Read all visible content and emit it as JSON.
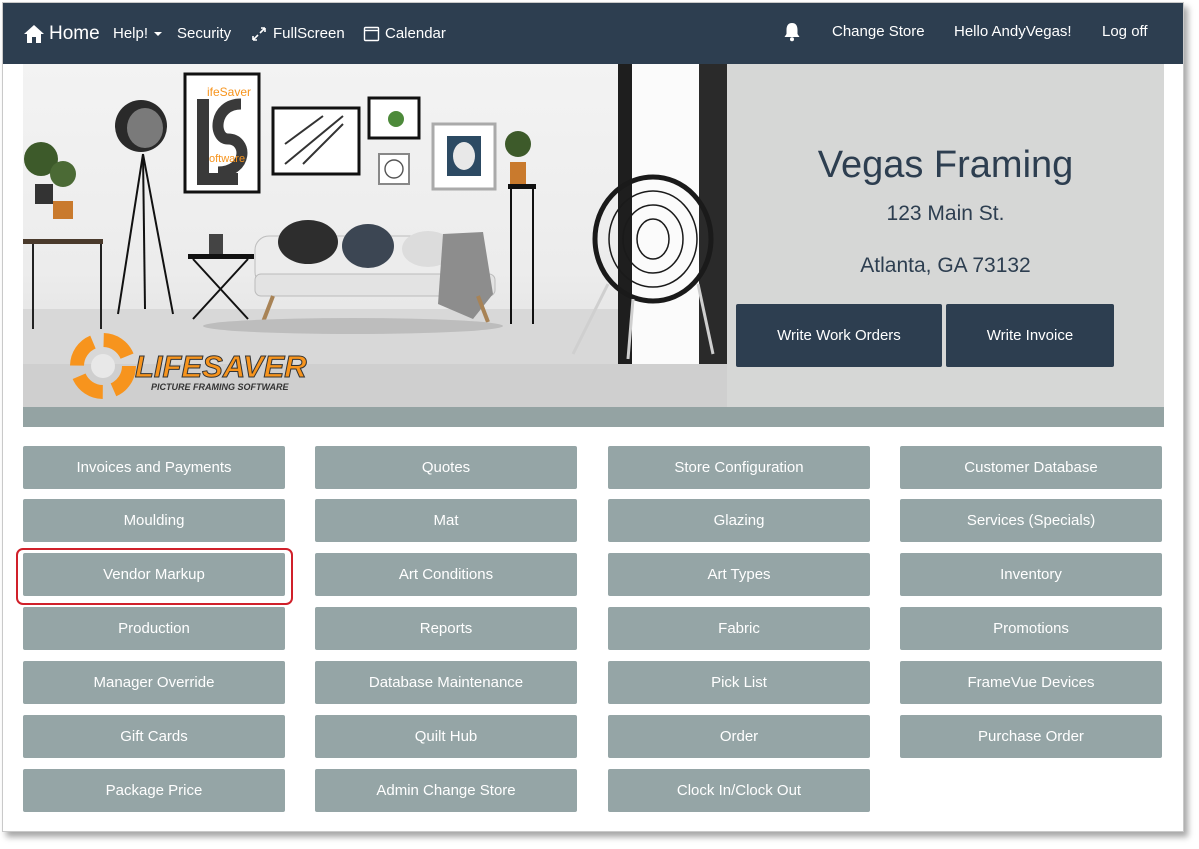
{
  "nav": {
    "home": "Home",
    "help": "Help!",
    "security": "Security",
    "fullscreen": "FullScreen",
    "calendar": "Calendar",
    "change_store": "Change Store",
    "hello": "Hello AndyVegas!",
    "logoff": "Log off"
  },
  "store": {
    "name": "Vegas Framing",
    "street": "123 Main St.",
    "city": "Atlanta, GA 73132"
  },
  "hero": {
    "write_work_orders": "Write Work Orders",
    "write_invoice": "Write Invoice",
    "logo_wordmark": "LIFESAVER",
    "logo_tagline": "PICTURE FRAMING SOFTWARE",
    "poster_text_top": "ifeSaver",
    "poster_text_bottom": "oftware"
  },
  "menu": {
    "col1": [
      "Invoices and Payments",
      "Moulding",
      "Vendor Markup",
      "Production",
      "Manager Override",
      "Gift Cards",
      "Package Price"
    ],
    "col2": [
      "Quotes",
      "Mat",
      "Art Conditions",
      "Reports",
      "Database Maintenance",
      "Quilt Hub",
      "Admin Change Store"
    ],
    "col3": [
      "Store Configuration",
      "Glazing",
      "Art Types",
      "Fabric",
      "Pick List",
      "Order",
      "Clock In/Clock Out"
    ],
    "col4": [
      "Customer Database",
      "Services (Specials)",
      "Inventory",
      "Promotions",
      "FrameVue Devices",
      "Purchase Order"
    ]
  },
  "colors": {
    "navbar": "#2d3e50",
    "grid_button": "#95a5a6",
    "highlight": "#d0202a",
    "brand_orange": "#f7941d"
  }
}
